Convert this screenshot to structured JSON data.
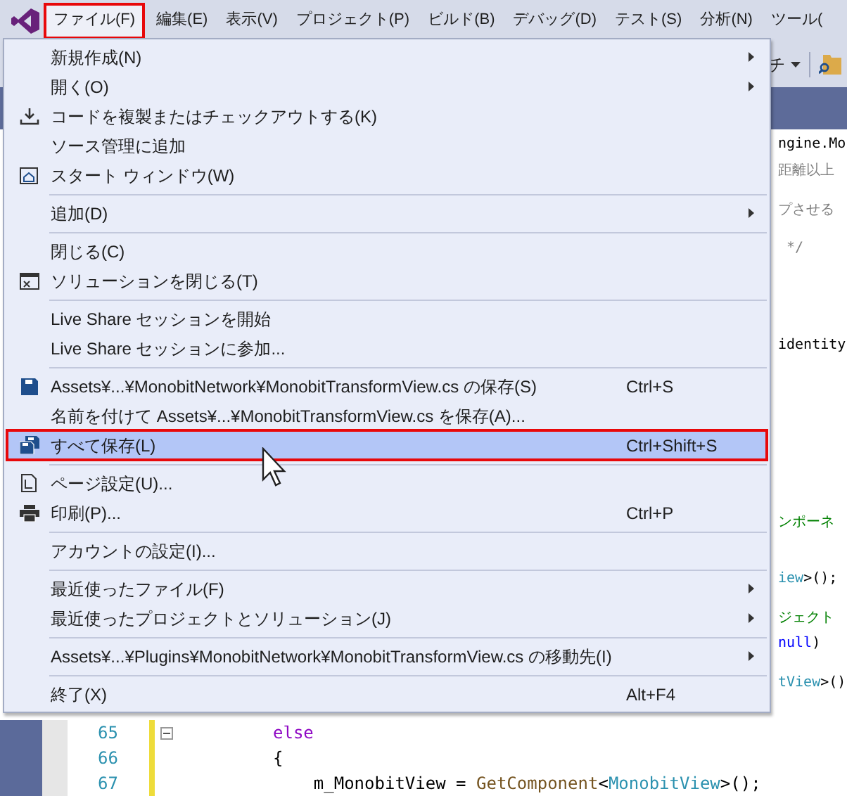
{
  "menubar": [
    {
      "label": "ファイル(F)",
      "selected": true
    },
    {
      "label": "編集(E)",
      "selected": false
    },
    {
      "label": "表示(V)",
      "selected": false
    },
    {
      "label": "プロジェクト(P)",
      "selected": false
    },
    {
      "label": "ビルド(B)",
      "selected": false
    },
    {
      "label": "デバッグ(D)",
      "selected": false
    },
    {
      "label": "テスト(S)",
      "selected": false
    },
    {
      "label": "分析(N)",
      "selected": false
    },
    {
      "label": "ツール(",
      "selected": false
    }
  ],
  "toolbar": {
    "dropdown_label": "チ"
  },
  "file_menu": [
    {
      "kind": "item",
      "label": "新規作成(N)",
      "submenu": true,
      "selected": false
    },
    {
      "kind": "item",
      "label": "開く(O)",
      "submenu": true,
      "selected": false
    },
    {
      "kind": "item",
      "label": "コードを複製またはチェックアウトする(K)",
      "submenu": false,
      "selected": false
    },
    {
      "kind": "item",
      "label": "ソース管理に追加",
      "submenu": false,
      "selected": false
    },
    {
      "kind": "item",
      "label": "スタート ウィンドウ(W)",
      "submenu": false,
      "selected": false
    },
    {
      "kind": "separator"
    },
    {
      "kind": "item",
      "label": "追加(D)",
      "submenu": true,
      "selected": false
    },
    {
      "kind": "separator"
    },
    {
      "kind": "item",
      "label": "閉じる(C)",
      "submenu": false,
      "selected": false
    },
    {
      "kind": "item",
      "label": "ソリューションを閉じる(T)",
      "submenu": false,
      "selected": false
    },
    {
      "kind": "separator"
    },
    {
      "kind": "item",
      "label": "Live Share セッションを開始",
      "submenu": false,
      "selected": false
    },
    {
      "kind": "item",
      "label": "Live Share セッションに参加...",
      "submenu": false,
      "selected": false
    },
    {
      "kind": "separator"
    },
    {
      "kind": "item",
      "label": "Assets¥...¥MonobitNetwork¥MonobitTransformView.cs の保存(S)",
      "shortcut": "Ctrl+S",
      "submenu": false,
      "selected": false
    },
    {
      "kind": "item",
      "label": "名前を付けて Assets¥...¥MonobitTransformView.cs を保存(A)...",
      "submenu": false,
      "selected": false
    },
    {
      "kind": "item",
      "label": "すべて保存(L)",
      "shortcut": "Ctrl+Shift+S",
      "submenu": false,
      "selected": true
    },
    {
      "kind": "separator"
    },
    {
      "kind": "item",
      "label": "ページ設定(U)...",
      "submenu": false,
      "selected": false
    },
    {
      "kind": "item",
      "label": "印刷(P)...",
      "shortcut": "Ctrl+P",
      "submenu": false,
      "selected": false
    },
    {
      "kind": "separator"
    },
    {
      "kind": "item",
      "label": "アカウントの設定(I)...",
      "submenu": false,
      "selected": false
    },
    {
      "kind": "separator"
    },
    {
      "kind": "item",
      "label": "最近使ったファイル(F)",
      "submenu": true,
      "selected": false
    },
    {
      "kind": "item",
      "label": "最近使ったプロジェクトとソリューション(J)",
      "submenu": true,
      "selected": false
    },
    {
      "kind": "separator"
    },
    {
      "kind": "item",
      "label": "Assets¥...¥Plugins¥MonobitNetwork¥MonobitTransformView.cs の移動先(I)",
      "submenu": true,
      "selected": false
    },
    {
      "kind": "separator"
    },
    {
      "kind": "item",
      "label": "終了(X)",
      "shortcut": "Alt+F4",
      "submenu": false,
      "selected": false
    }
  ],
  "code_fragments": [
    [
      {
        "kind": "plain",
        "text": "ngine.Mo"
      }
    ],
    [
      {
        "kind": "muted",
        "text": "距離以上"
      }
    ],
    [
      {
        "kind": "muted",
        "text": "プさせる"
      }
    ],
    [
      {
        "kind": "muted",
        "text": " */"
      }
    ],
    [
      {
        "kind": "plain",
        "text": "identity"
      }
    ],
    [
      {
        "kind": "comment",
        "text": "ンポーネ"
      }
    ],
    [
      {
        "kind": "type",
        "text": "iew"
      },
      {
        "kind": "plain",
        "text": ">();"
      }
    ],
    [
      {
        "kind": "comment",
        "text": "ジェクト"
      }
    ],
    [
      {
        "kind": "keyword",
        "text": "null"
      },
      {
        "kind": "plain",
        "text": ")"
      }
    ],
    [
      {
        "kind": "type",
        "text": "tView"
      },
      {
        "kind": "plain",
        "text": ">()"
      }
    ]
  ],
  "code_lines": [
    {
      "number": "65",
      "collapsible": true,
      "tokens": [
        {
          "kind": "control",
          "text": "else"
        }
      ]
    },
    {
      "number": "66",
      "collapsible": false,
      "tokens": [
        {
          "kind": "plain",
          "text": "{"
        }
      ]
    },
    {
      "number": "67",
      "collapsible": false,
      "tokens": [
        {
          "kind": "plain",
          "text": "    m_MonobitView = "
        },
        {
          "kind": "method",
          "text": "GetComponent"
        },
        {
          "kind": "plain",
          "text": "<"
        },
        {
          "kind": "type",
          "text": "MonobitView"
        },
        {
          "kind": "plain",
          "text": ">();"
        }
      ]
    }
  ]
}
